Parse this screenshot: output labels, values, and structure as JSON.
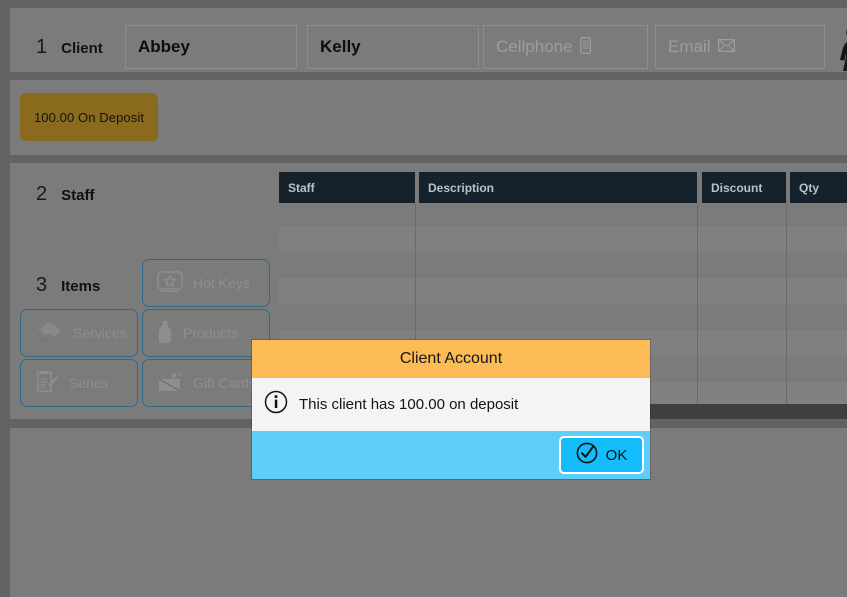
{
  "client_section": {
    "step_number": "1",
    "step_label": "Client",
    "first_name": "Abbey",
    "last_name": "Kelly",
    "cellphone_placeholder": "Cellphone",
    "cellphone_value": "",
    "email_placeholder": "Email",
    "email_value": "",
    "phone_icon": "phone-icon",
    "email_icon": "envelope-icon",
    "avatar_icon": "female-person-icon"
  },
  "deposit": {
    "badge_label": "100.00 On Deposit",
    "badge_color": "#8a6a1d"
  },
  "staff_section": {
    "step_number": "2",
    "step_label": "Staff"
  },
  "items_section": {
    "step_number": "3",
    "step_label": "Items",
    "buttons": [
      {
        "label": "Hot Keys",
        "icon": "star-box-icon"
      },
      {
        "label": "Services",
        "icon": "hands-icon"
      },
      {
        "label": "Products",
        "icon": "bottle-icon"
      },
      {
        "label": "Series",
        "icon": "clipboard-pencil-icon"
      },
      {
        "label": "Gift Cards",
        "icon": "gift-card-icon"
      }
    ],
    "border_color": "#2e6b8b"
  },
  "ticket_table": {
    "columns": [
      "Staff",
      "Description",
      "Discount",
      "Qty"
    ],
    "header_bg": "#16222b",
    "header_text_color": "#b9c2c6",
    "rows": []
  },
  "dialog": {
    "title": "Client Account",
    "message": "This client has 100.00 on deposit",
    "info_icon": "info-circle-icon",
    "ok_label": "OK",
    "ok_icon": "check-circle-icon",
    "header_color": "#fbbb55",
    "footer_color": "#5dcef9",
    "button_color": "#13bdfb"
  }
}
